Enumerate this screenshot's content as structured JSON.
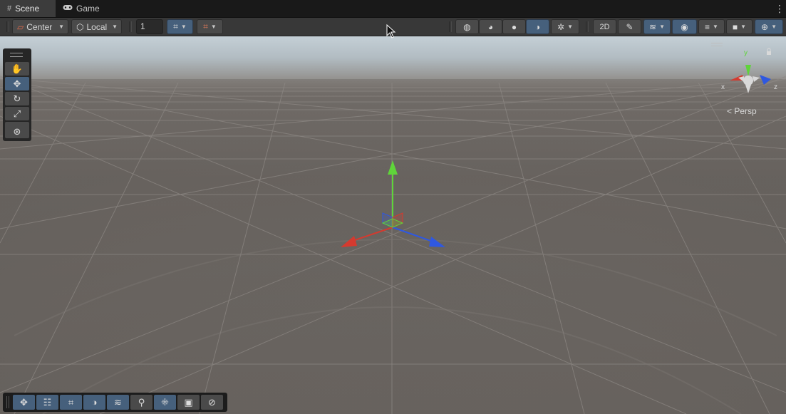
{
  "tabs": [
    {
      "label": "Scene",
      "icon": "grid-icon",
      "active": true
    },
    {
      "label": "Game",
      "icon": "gamepad-icon",
      "active": false
    }
  ],
  "toolbar": {
    "pivot_label": "Center",
    "space_label": "Local",
    "grid_size_value": "1"
  },
  "scene": {
    "camera_mode_label": "< Persp",
    "gizmo_axes": {
      "x": "x",
      "y": "y",
      "z": "z"
    }
  },
  "colors": {
    "axis_x": "#d43a2f",
    "axis_y": "#5fd43a",
    "axis_z": "#2f58e0",
    "active_button": "#46607c"
  }
}
